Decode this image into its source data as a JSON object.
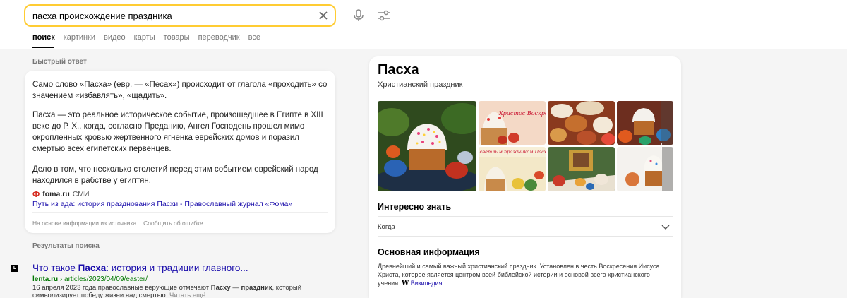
{
  "search": {
    "query": "пасха происхождение праздника",
    "tabs": [
      "поиск",
      "картинки",
      "видео",
      "карты",
      "товары",
      "переводчик",
      "все"
    ]
  },
  "quick_answer": {
    "label": "Быстрый ответ",
    "paragraphs": [
      "Само слово «Пасха» (евр. — «Песах») происходит от глагола «проходить» со значением «избавлять», «щадить».",
      "Пасха — это реальное историческое событие, произошедшее в Египте в XIII веке до Р. Х., когда, согласно Преданию, Ангел Господень прошел мимо окропленных кровью жертвенного ягненка еврейских домов и поразил смертью всех египетских первенцев.",
      "Дело в том, что несколько столетий перед этим событием еврейский народ находился в рабстве у египтян."
    ],
    "source_logo": "Ф",
    "source_name": "foma.ru",
    "source_type": "СМИ",
    "source_link": "Путь из ада: история празднования Пасхи - Православный журнал «Фома»",
    "footer_note": "На основе информации из источника",
    "footer_report": "Сообщить об ошибке"
  },
  "results": {
    "label": "Результаты поиска",
    "items": [
      {
        "favicon": "L",
        "title_pre": "Что такое ",
        "title_bold": "Пасха",
        "title_post": ": история и традиции главного...",
        "domain": "lenta.ru",
        "path": " › articles/2023/04/09/easter/",
        "snippet_a": "16 апреля 2023 года православные верующие отмечают ",
        "snippet_b": "Пасху",
        "snippet_c": " — ",
        "snippet_d": "праздник",
        "snippet_e": ", который символизирует победу жизни над смертью. ",
        "snippet_more": "Читать ещё"
      }
    ]
  },
  "knowledge_panel": {
    "title": "Пасха",
    "subtitle": "Христианский праздник",
    "gallery": {
      "caption_1": "Христос Воскресе!",
      "caption_2": "Со светлым праздником Пасхи!"
    },
    "interesting_heading": "Интересно знать",
    "accordion_item": "Когда",
    "main_info_heading": "Основная информация",
    "main_info_text": "Древнейший и самый важный христианский праздник. Установлен в честь Воскресения Иисуса Христа, которое является центром всей библейской истории и основой всего христианского учения.",
    "wiki_icon": "W",
    "wiki_link": "Википедия"
  },
  "colors": {
    "accent": "#ffcc33",
    "link": "#1a0dab",
    "url_green": "#007700",
    "source_red": "#d62a1e"
  }
}
